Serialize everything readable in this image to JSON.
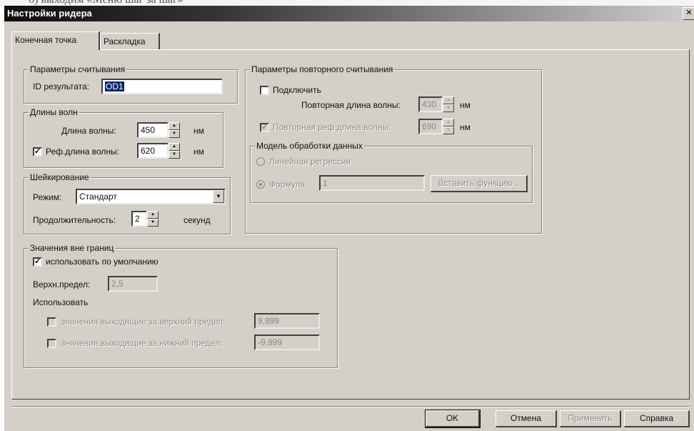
{
  "background_caption": "б) выходим «Меню шаг за шаг»",
  "window": {
    "title": "Настройки ридера",
    "close_glyph": "✕"
  },
  "tabs": [
    {
      "label": "Конечная точка",
      "active": true
    },
    {
      "label": "Раскладка",
      "active": false
    }
  ],
  "read_params": {
    "legend": "Параметры считывания",
    "result_id_label": "ID результата:",
    "result_id_value": "OD1"
  },
  "wavelengths": {
    "legend": "Длины волн",
    "wavelength_label": "Длина волны:",
    "wavelength_value": "450",
    "wavelength_unit": "нм",
    "ref_checked": true,
    "ref_label": "Реф.длина волны:",
    "ref_value": "620",
    "ref_unit": "нм"
  },
  "shaking": {
    "legend": "Шейкирование",
    "mode_label": "Режим:",
    "mode_value": "Стандарт",
    "duration_label": "Продолжительность:",
    "duration_value": "2",
    "duration_unit": "секунд"
  },
  "out_of_range": {
    "legend": "Значения вне границ",
    "use_default_checked": true,
    "use_default_label": "использовать по умолчанию",
    "upper_limit_label": "Верхн.предел:",
    "upper_limit_value": "2,5",
    "use_label": "Использовать",
    "above_label": "значения выходящие за верхний предел:",
    "above_value": "9,999",
    "below_label": "значения выходящие за нижний предел:",
    "below_value": "-9,999"
  },
  "reread": {
    "legend": "Параметры повторного считывания",
    "enable_label": "Подключить",
    "enable_checked": false,
    "rewave_label": "Повторная длина волны:",
    "rewave_value": "430",
    "rewave_unit": "нм",
    "reref_label": "Повторная реф.длина волны:",
    "reref_value": "690",
    "reref_unit": "нм",
    "reref_checked": true
  },
  "data_model": {
    "legend": "Модель обработки данных",
    "linear_label": "Линейная регрессия",
    "formula_label": "Формула",
    "formula_value": "1",
    "insert_button": "Вставить функцию..."
  },
  "footer": {
    "ok": "OK",
    "cancel": "Отмена",
    "apply": "Применить",
    "help": "Справка"
  },
  "icons": {
    "spin_up": "▲",
    "spin_down": "▼",
    "combo_arrow": "▼",
    "check_mark": "✓"
  }
}
